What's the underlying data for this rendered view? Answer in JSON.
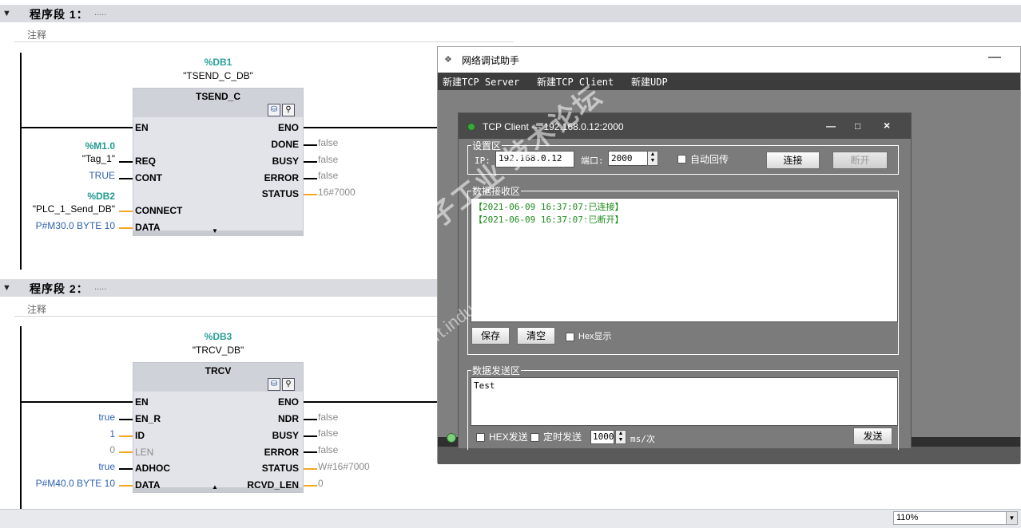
{
  "editor": {
    "network1": {
      "title": "程序段 1：",
      "dots": ".....",
      "comment": "注释",
      "db_name": "%DB1",
      "db_quote": "\"TSEND_C_DB\"",
      "block_name": "TSEND_C",
      "left_pins": [
        "EN",
        "REQ",
        "CONT",
        "CONNECT",
        "DATA"
      ],
      "right_pins": [
        "ENO",
        "DONE",
        "BUSY",
        "ERROR",
        "STATUS"
      ],
      "req_addr": "%M1.0",
      "req_tag": "\"Tag_1\"",
      "cont_value": "TRUE",
      "connect_addr": "%DB2",
      "connect_tag": "\"PLC_1_Send_DB\"",
      "data_value": "P#M30.0 BYTE 10",
      "done_value": "false",
      "busy_value": "false",
      "error_value": "false",
      "status_value": "16#7000"
    },
    "network2": {
      "title": "程序段 2：",
      "dots": ".....",
      "comment": "注释",
      "db_name": "%DB3",
      "db_quote": "\"TRCV_DB\"",
      "block_name": "TRCV",
      "left_pins": [
        "EN",
        "EN_R",
        "ID",
        "LEN",
        "ADHOC",
        "DATA"
      ],
      "right_pins": [
        "ENO",
        "NDR",
        "BUSY",
        "ERROR",
        "STATUS",
        "RCVD_LEN"
      ],
      "en_r_value": "true",
      "id_value": "1",
      "len_value": "0",
      "adhoc_value": "true",
      "data_value": "P#M40.0 BYTE 10",
      "ndr_value": "false",
      "busy_value": "false",
      "error_value": "false",
      "status_value": "W#16#7000",
      "rcvd_len_value": "0"
    },
    "zoom": "110%"
  },
  "assistant": {
    "title": "网络调试助手",
    "minimize": "—",
    "menu": [
      "新建TCP Server",
      "新建TCP Client",
      "新建UDP"
    ],
    "child": {
      "title": "TCP Client --- 192.168.0.12:2000",
      "btn_min": "—",
      "btn_max": "□",
      "btn_close": "×",
      "settings_group": "设置区",
      "ip_label": "IP:",
      "ip_value": "192.168.0.12",
      "port_label": "端口:",
      "port_value": "2000",
      "auto_reply": "自动回传",
      "connect_btn": "连接",
      "disconnect_btn": "断开",
      "receive_group": "数据接收区",
      "log": [
        "【2021-06-09 16:37:07:已连接】",
        "【2021-06-09 16:37:07:已断开】"
      ],
      "save_btn": "保存",
      "clear_btn": "清空",
      "hex_display": "Hex显示",
      "send_group": "数据发送区",
      "send_text": "Test",
      "hex_send": "HEX发送",
      "timed_send": "定时发送",
      "interval": "1000",
      "interval_unit": "ms/次",
      "send_btn": "发送"
    }
  },
  "watermark": {
    "cn": "西门子工业  技术论坛",
    "url": "support.industry.siemens.com/cs"
  }
}
